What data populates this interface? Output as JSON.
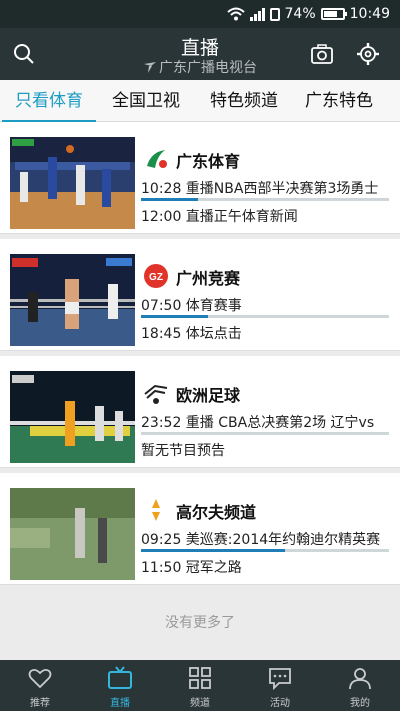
{
  "status_bar": {
    "battery": "74%",
    "time": "10:49",
    "network": "4G"
  },
  "header": {
    "title": "直播",
    "subtitle": "广东广播电视台",
    "search_icon": "search-icon",
    "camera_icon": "camera-icon",
    "settings_icon": "gear-icon"
  },
  "tabs": [
    {
      "label": "只看体育"
    },
    {
      "label": "全国卫视"
    },
    {
      "label": "特色频道"
    },
    {
      "label": "广东特色"
    }
  ],
  "channels": [
    {
      "name": "广东体育",
      "logo_color": "#1a8f4a",
      "now": "10:28  重播NBA西部半决赛第3场勇士",
      "progress": 0.23,
      "next": "12:00  直播正午体育新闻"
    },
    {
      "name": "广州竞赛",
      "logo_color": "#e0342a",
      "now": "07:50  体育赛事",
      "progress": 0.27,
      "next": "18:45  体坛点击"
    },
    {
      "name": "欧洲足球",
      "logo_color": "#222222",
      "now": "23:52  重播 CBA总决赛第2场 辽宁vs",
      "progress": 0.0,
      "next": "暂无节目预告"
    },
    {
      "name": "高尔夫频道",
      "logo_color": "#f0a020",
      "now": "09:25  美巡赛:2014年约翰迪尔精英赛",
      "progress": 0.58,
      "next": "11:50  冠军之路"
    }
  ],
  "no_more": "没有更多了",
  "bottom_nav": [
    {
      "label": "推荐",
      "icon": "heart-icon"
    },
    {
      "label": "直播",
      "icon": "tv-icon"
    },
    {
      "label": "频道",
      "icon": "grid-icon"
    },
    {
      "label": "活动",
      "icon": "chat-icon"
    },
    {
      "label": "我的",
      "icon": "person-icon"
    }
  ],
  "colors": {
    "accent": "#1e9cc4",
    "header_bg": "#2a3537",
    "progress": "#1e7fb8"
  }
}
